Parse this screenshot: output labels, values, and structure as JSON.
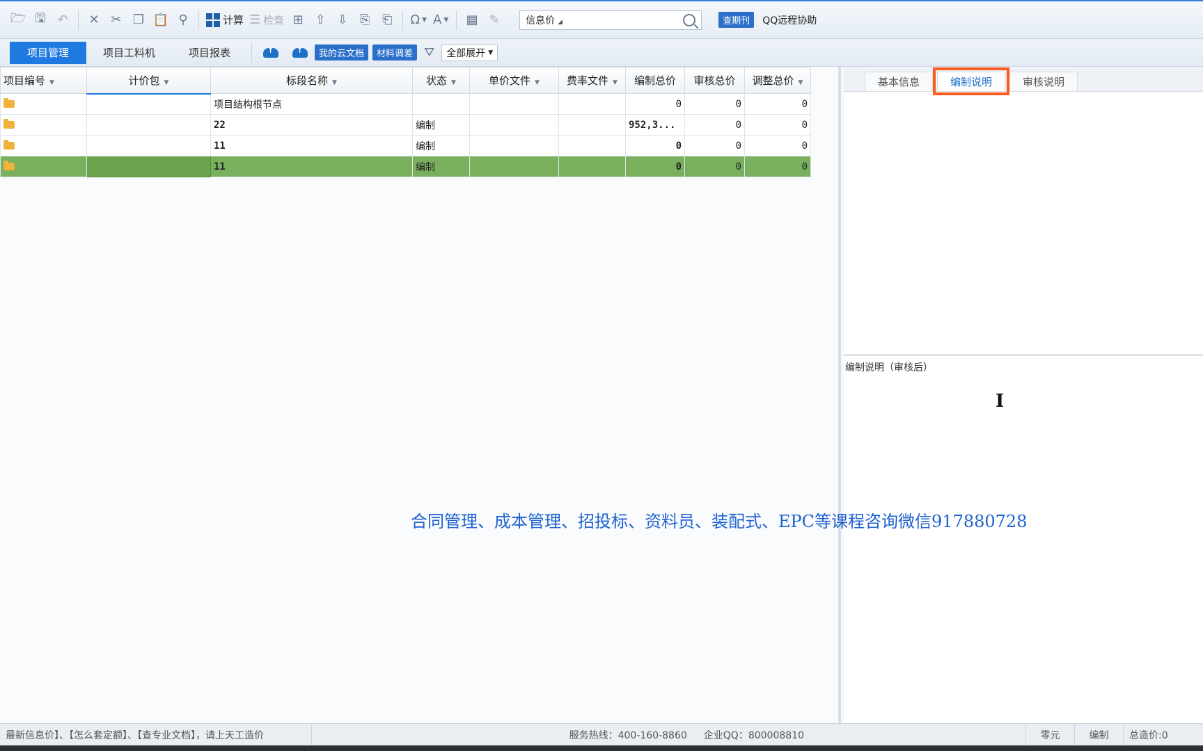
{
  "toolbar": {
    "calc_label": "计算",
    "check_label": "检查",
    "info_combo_value": "信息价",
    "period_tag": "查期刊",
    "qq_help": "QQ远程协助"
  },
  "tabs": {
    "project_mgmt": "项目管理",
    "project_labor": "项目工料机",
    "project_report": "项目报表",
    "my_cloud": "我的云文档",
    "material_adjust": "材料调差",
    "expand_all": "全部展开"
  },
  "grid": {
    "columns": [
      "项目编号",
      "计价包",
      "标段名称",
      "状态",
      "单价文件",
      "费率文件",
      "编制总价",
      "审核总价",
      "调整总价"
    ],
    "rows": [
      {
        "name": "项目结构根节点",
        "status": "",
        "compiled": "0",
        "audited": "0",
        "adjusted": "0"
      },
      {
        "name": "22",
        "status": "编制",
        "compiled": "952,3...",
        "audited": "0",
        "adjusted": "0"
      },
      {
        "name": "11",
        "status": "编制",
        "compiled": "0",
        "audited": "0",
        "adjusted": "0"
      },
      {
        "name": "11",
        "status": "编制",
        "compiled": "0",
        "audited": "0",
        "adjusted": "0"
      }
    ]
  },
  "right_panel": {
    "tabs": [
      "基本信息",
      "编制说明",
      "审核说明"
    ],
    "active_tab": "编制说明",
    "lower_label": "编制说明（审核后）"
  },
  "watermark": "合同管理、成本管理、招投标、资料员、装配式、EPC等课程咨询微信917880728",
  "statusbar": {
    "news": "最新信息价】、【怎么套定额】、【查专业文档】，请上天工造价",
    "hotline": "服务热线：400-160-8860",
    "qq": "企业QQ：800008810",
    "unit": "零元",
    "mode": "编制",
    "total": "总造价:0"
  },
  "colors": {
    "accent": "#1e7ae0",
    "selected_row": "#79b05e",
    "highlight_box": "#ff5a1f",
    "watermark": "#1e62d0"
  }
}
